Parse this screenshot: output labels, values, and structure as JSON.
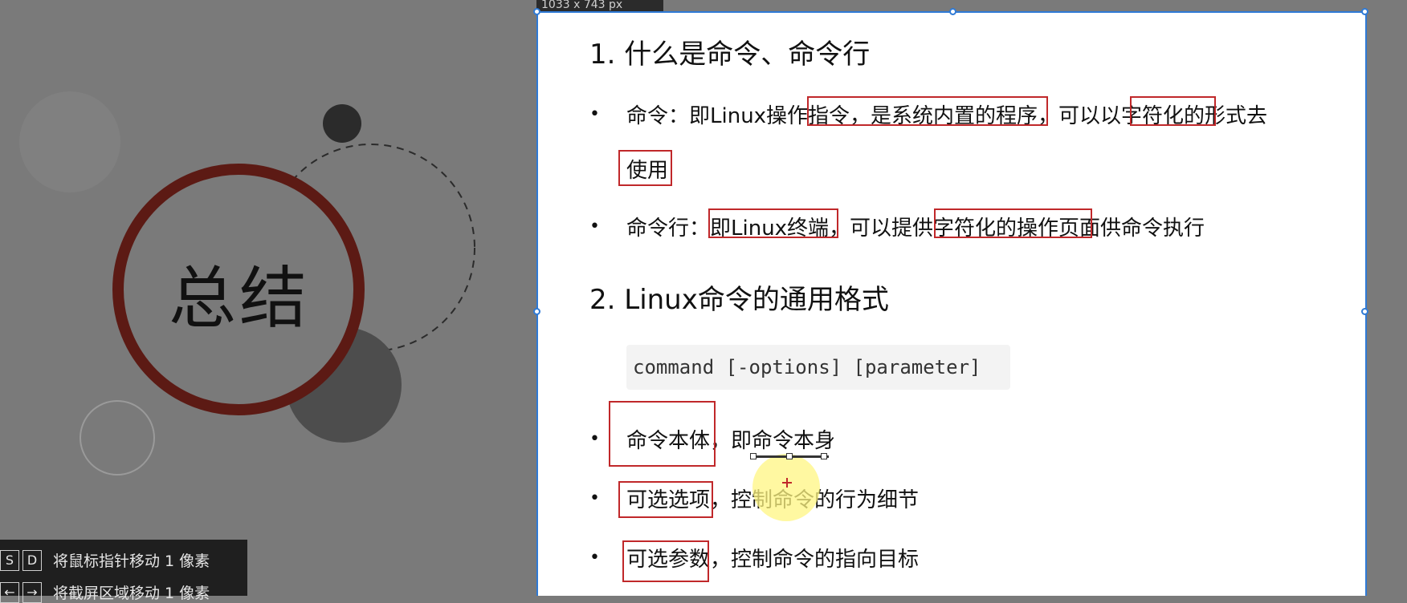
{
  "slide": {
    "title": "总结"
  },
  "dimension_badge": "1033 x 743  px",
  "hints": [
    {
      "keys": [
        "S",
        "D"
      ],
      "text": "将鼠标指针移动 1 像素"
    },
    {
      "keys": [
        "←",
        "→"
      ],
      "text": "将截屏区域移动 1 像素"
    }
  ],
  "doc": {
    "section1_title": "1. 什么是命令、命令行",
    "section1_bullets": [
      {
        "line1": "命令：即Linux操作指令，是系统内置的程序，可以以字符化的形式去",
        "line2": "使用"
      },
      {
        "line1": "命令行：即Linux终端，可以提供字符化的操作页面供命令执行"
      }
    ],
    "section2_title": "2. Linux命令的通用格式",
    "code": "command [-options] [parameter]",
    "section2_bullets": [
      "命令本体，即命令本身",
      "可选选项，控制命令的行为细节",
      "可选参数，控制命令的指向目标"
    ],
    "bullet_symbol": "•"
  },
  "colors": {
    "accent_blue": "#2f7ad6",
    "annotation_red": "#c0282a",
    "ring_dark_red": "#5c1a14"
  }
}
